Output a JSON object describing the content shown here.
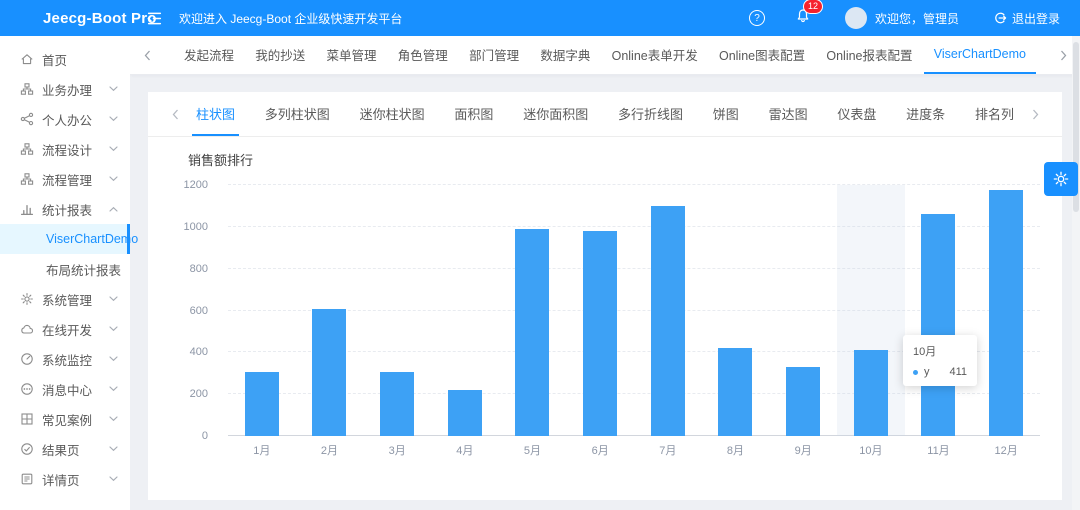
{
  "header": {
    "logo_text": "Jeecg-Boot Pro",
    "welcome_text": "欢迎进入 Jeecg-Boot 企业级快速开发平台",
    "notification_count": "12",
    "user_greeting": "欢迎您，管理员",
    "logout_label": "退出登录",
    "icons": [
      "menu-fold-icon",
      "question-circle-icon",
      "bell-icon",
      "logout-icon"
    ]
  },
  "colors": {
    "primary": "#1890ff",
    "bar": "#3da1f5",
    "active_item_bg": "#e6f7ff",
    "badge_red": "#f5222d",
    "content_bg": "#eef0f4"
  },
  "sidebar": {
    "items": [
      {
        "id": "home",
        "label": "首页",
        "icon": "home-icon"
      },
      {
        "id": "business",
        "label": "业务办理",
        "icon": "cluster-icon",
        "expandable": true
      },
      {
        "id": "personal-office",
        "label": "个人办公",
        "icon": "share-icon",
        "expandable": true
      },
      {
        "id": "process-design",
        "label": "流程设计",
        "icon": "cluster-icon",
        "expandable": true
      },
      {
        "id": "process-management",
        "label": "流程管理",
        "icon": "cluster-icon",
        "expandable": true
      },
      {
        "id": "report",
        "label": "统计报表",
        "icon": "bar-chart-icon",
        "expandable": true,
        "expanded": true
      },
      {
        "id": "viser-chart-demo",
        "label": "ViserChartDemo",
        "child": true,
        "active": true
      },
      {
        "id": "layout-report",
        "label": "布局统计报表",
        "child": true
      },
      {
        "id": "system-management",
        "label": "系统管理",
        "icon": "gear-icon",
        "expandable": true
      },
      {
        "id": "online-dev",
        "label": "在线开发",
        "icon": "cloud-icon",
        "expandable": true
      },
      {
        "id": "system-monitor",
        "label": "系统监控",
        "icon": "dashboard-icon",
        "expandable": true
      },
      {
        "id": "message-center",
        "label": "消息中心",
        "icon": "message-icon",
        "expandable": true
      },
      {
        "id": "common-case",
        "label": "常见案例",
        "icon": "grid-icon",
        "expandable": true
      },
      {
        "id": "result-page",
        "label": "结果页",
        "icon": "check-circle-icon",
        "expandable": true
      },
      {
        "id": "detail-page",
        "label": "详情页",
        "icon": "profile-icon",
        "expandable": true
      }
    ]
  },
  "page_tabs": {
    "active_index": 9,
    "items": [
      "发起流程",
      "我的抄送",
      "菜单管理",
      "角色管理",
      "部门管理",
      "数据字典",
      "Online表单开发",
      "Online图表配置",
      "Online报表配置",
      "ViserChartDemo"
    ]
  },
  "chart_tabs": {
    "active_index": 0,
    "items": [
      "柱状图",
      "多列柱状图",
      "迷你柱状图",
      "面积图",
      "迷你面积图",
      "多行折线图",
      "饼图",
      "雷达图",
      "仪表盘",
      "进度条",
      "排名列"
    ]
  },
  "chart_data": {
    "type": "bar",
    "title": "销售额排行",
    "categories": [
      "1月",
      "2月",
      "3月",
      "4月",
      "5月",
      "6月",
      "7月",
      "8月",
      "9月",
      "10月",
      "11月",
      "12月"
    ],
    "series": [
      {
        "name": "y",
        "values": [
          305,
          605,
          305,
          220,
          990,
          980,
          1100,
          420,
          330,
          411,
          1060,
          1175
        ]
      }
    ],
    "xlabel": "",
    "ylabel": "",
    "y_ticks": [
      0,
      200,
      400,
      600,
      800,
      1000,
      1200
    ],
    "ylim": [
      0,
      1200
    ],
    "grid": "dashed-horizontal",
    "legend_position": "none",
    "bar_color": "#3da1f5",
    "highlighted_category": "10月",
    "tooltip": {
      "title": "10月",
      "series": "y",
      "value": "411"
    }
  }
}
